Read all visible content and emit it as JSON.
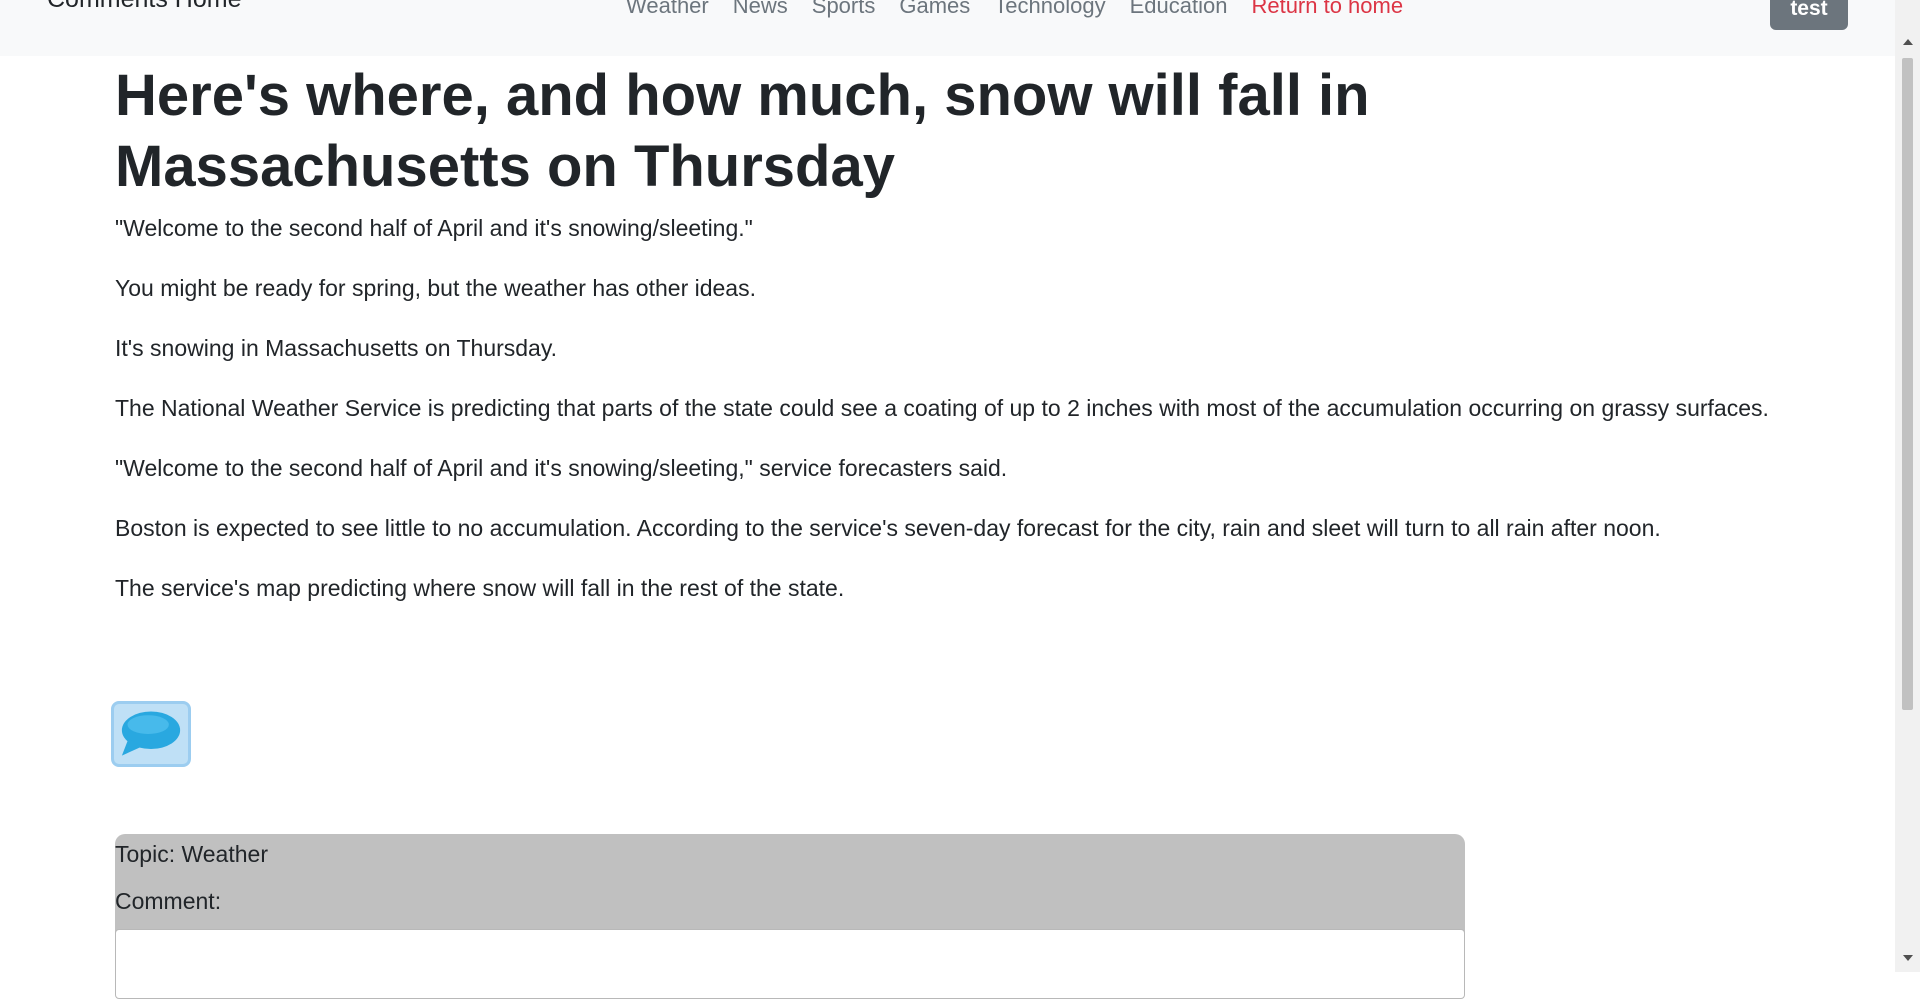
{
  "navbar": {
    "brand": "Comments Home",
    "links": [
      "Weather",
      "News",
      "Sports",
      "Games",
      "Technology",
      "Education"
    ],
    "home_link": "Return to home",
    "user_button": "test"
  },
  "article": {
    "title": "Here's where, and how much, snow will fall in Massachusetts on Thursday",
    "paragraphs": [
      "\"Welcome to the second half of April and it's snowing/sleeting.\"",
      "You might be ready for spring, but the weather has other ideas.",
      "It's snowing in Massachusetts on Thursday.",
      "The National Weather Service is predicting that parts of the state could see a coating of up to 2 inches with most of the accumulation occurring on grassy surfaces.",
      "\"Welcome to the second half of April and it's snowing/sleeting,\" service forecasters said.",
      "Boston is expected to see little to no accumulation. According to the service's seven-day forecast for the city, rain and sleet will turn to all rain after noon.",
      "The service's map predicting where snow will fall in the rest of the state."
    ]
  },
  "comment_button": {
    "icon": "speech-bubble-icon",
    "color": "#29a8e0"
  },
  "comment_form": {
    "topic": "Topic: Weather",
    "comment_label": "Comment:",
    "comment_value": ""
  },
  "colors": {
    "navbar_bg": "#f8f9fa",
    "nav_link": "#6c757d",
    "home_link": "#dc3545",
    "user_button_bg": "#6c757d",
    "form_panel_bg": "#c0c0c0"
  }
}
